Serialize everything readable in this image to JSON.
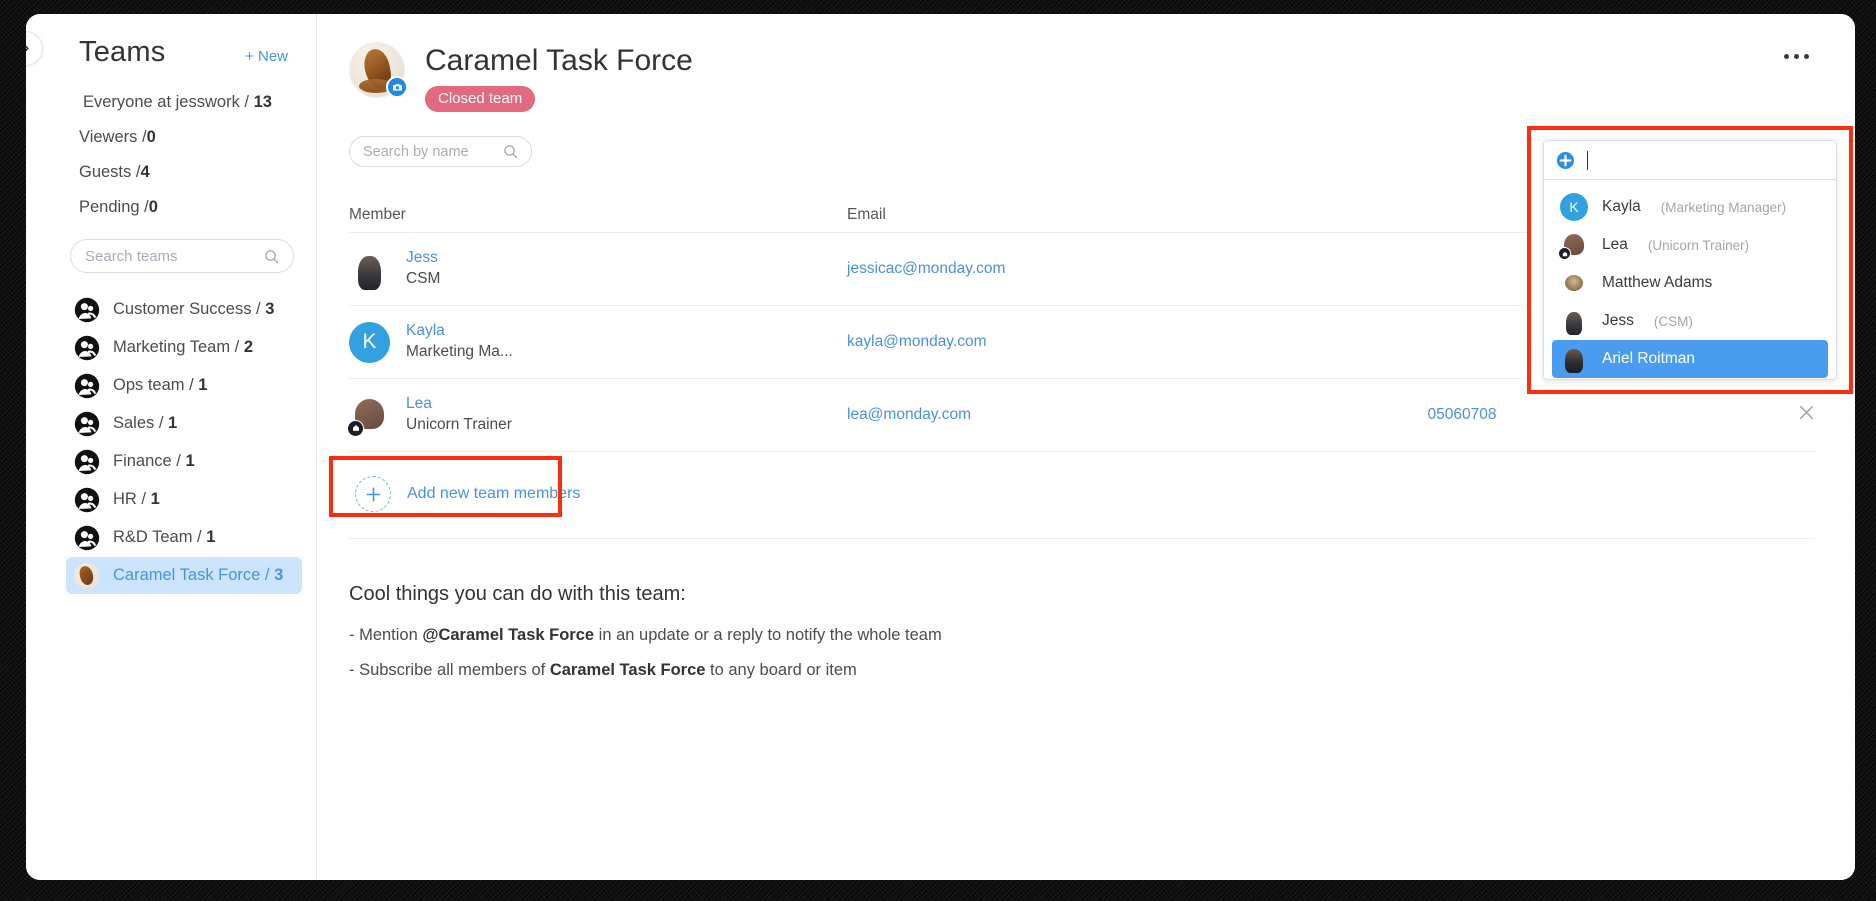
{
  "sidebar": {
    "title": "Teams",
    "new_label": "+ New",
    "collapse_icon": "chevron-right-icon",
    "scopes": [
      {
        "label": "Everyone at jesswork /",
        "count": "13"
      },
      {
        "label": "Viewers /",
        "count": "0"
      },
      {
        "label": "Guests /",
        "count": "4"
      },
      {
        "label": "Pending /",
        "count": "0"
      }
    ],
    "search": {
      "placeholder": "Search teams",
      "value": "",
      "icon": "search-icon"
    },
    "teams": [
      {
        "label": "Customer Success /",
        "count": "3",
        "icon": "team-group-icon",
        "selected": false
      },
      {
        "label": "Marketing Team /",
        "count": "2",
        "icon": "team-group-icon",
        "selected": false
      },
      {
        "label": "Ops team /",
        "count": "1",
        "icon": "team-group-icon",
        "selected": false
      },
      {
        "label": "Sales /",
        "count": "1",
        "icon": "team-group-icon",
        "selected": false
      },
      {
        "label": "Finance /",
        "count": "1",
        "icon": "team-group-icon",
        "selected": false
      },
      {
        "label": "HR /",
        "count": "1",
        "icon": "team-group-icon",
        "selected": false
      },
      {
        "label": "R&D Team /",
        "count": "1",
        "icon": "team-group-icon",
        "selected": false
      },
      {
        "label": "Caramel Task Force /",
        "count": "3",
        "icon": "caramel-photo-avatar",
        "selected": true
      }
    ]
  },
  "header": {
    "team_title": "Caramel Task Force",
    "badge": "Closed team",
    "photo_icon": "team-photo-avatar",
    "camera_icon": "camera-icon",
    "kebab_icon": "more-options-icon",
    "search": {
      "placeholder": "Search by name",
      "value": "",
      "icon": "search-icon"
    }
  },
  "table": {
    "columns": {
      "member": "Member",
      "email": "Email",
      "phone": "",
      "actions": ""
    },
    "rows": [
      {
        "name": "Jess",
        "role": "CSM",
        "email": "jessicac@monday.com",
        "phone": "",
        "avatar": "jess-photo-avatar",
        "avatar_initial": "",
        "admin_badge": false
      },
      {
        "name": "Kayla",
        "role": "Marketing Ma...",
        "email": "kayla@monday.com",
        "phone": "",
        "avatar": "kayla-initial-avatar",
        "avatar_initial": "K",
        "admin_badge": false
      },
      {
        "name": "Lea",
        "role": "Unicorn Trainer",
        "email": "lea@monday.com",
        "phone": "05060708",
        "avatar": "lea-photo-avatar",
        "avatar_initial": "",
        "admin_badge": true
      }
    ],
    "remove_icon": "close-x-icon"
  },
  "add_members": {
    "label": "Add new team members",
    "plus_icon": "plus-icon",
    "highlight_color": "#fb2e12"
  },
  "cool_things": {
    "heading": "Cool things you can do with this team:",
    "line1_pre": "- Mention ",
    "line1_bold": "@Caramel Task Force",
    "line1_post": " in an update or a reply to notify the whole team",
    "line2_pre": "- Subscribe all members of ",
    "line2_bold": "Caramel Task Force",
    "line2_post": " to any board or item"
  },
  "dropdown": {
    "input": {
      "value": "",
      "placeholder": "",
      "icon": "add-person-icon"
    },
    "highlight_color": "#fb2e12",
    "selected_color": "#4a9cf0",
    "options": [
      {
        "name": "Kayla",
        "sub": "(Marketing Manager)",
        "avatar": "kayla-initial-avatar",
        "initial": "K",
        "admin_badge": false,
        "selected": false
      },
      {
        "name": "Lea",
        "sub": "(Unicorn Trainer)",
        "avatar": "lea-photo-avatar",
        "initial": "",
        "admin_badge": true,
        "selected": false
      },
      {
        "name": "Matthew Adams",
        "sub": "",
        "avatar": "matthew-photo-avatar",
        "initial": "",
        "admin_badge": false,
        "selected": false
      },
      {
        "name": "Jess",
        "sub": "(CSM)",
        "avatar": "jess-photo-avatar",
        "initial": "",
        "admin_badge": false,
        "selected": false
      },
      {
        "name": "Ariel Roitman",
        "sub": "",
        "avatar": "ariel-photo-avatar",
        "initial": "",
        "admin_badge": false,
        "selected": true
      }
    ]
  },
  "colors": {
    "accent_blue": "#4a90e2",
    "badge_pink": "#e2697f",
    "annotation_red": "#fb2e12",
    "selected_bg": "#cce5ff"
  }
}
